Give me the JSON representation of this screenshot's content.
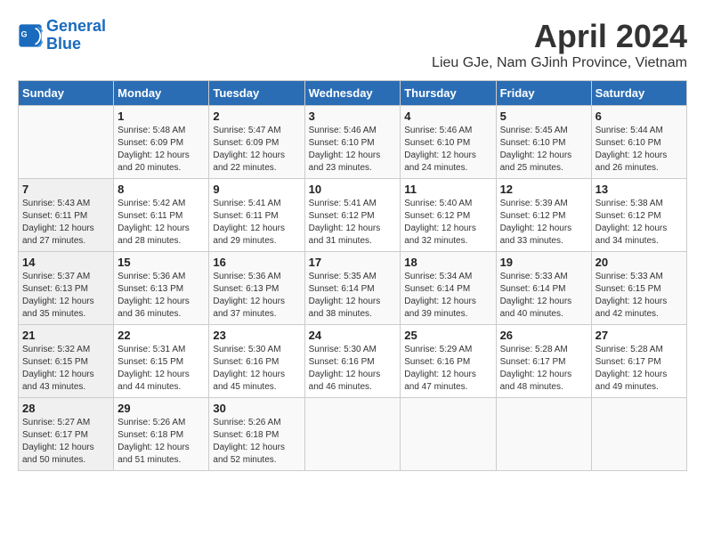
{
  "header": {
    "logo_line1": "General",
    "logo_line2": "Blue",
    "title": "April 2024",
    "subtitle": "Lieu GJe, Nam GJinh Province, Vietnam"
  },
  "calendar": {
    "days_of_week": [
      "Sunday",
      "Monday",
      "Tuesday",
      "Wednesday",
      "Thursday",
      "Friday",
      "Saturday"
    ],
    "weeks": [
      [
        {
          "day": "",
          "info": ""
        },
        {
          "day": "1",
          "info": "Sunrise: 5:48 AM\nSunset: 6:09 PM\nDaylight: 12 hours\nand 20 minutes."
        },
        {
          "day": "2",
          "info": "Sunrise: 5:47 AM\nSunset: 6:09 PM\nDaylight: 12 hours\nand 22 minutes."
        },
        {
          "day": "3",
          "info": "Sunrise: 5:46 AM\nSunset: 6:10 PM\nDaylight: 12 hours\nand 23 minutes."
        },
        {
          "day": "4",
          "info": "Sunrise: 5:46 AM\nSunset: 6:10 PM\nDaylight: 12 hours\nand 24 minutes."
        },
        {
          "day": "5",
          "info": "Sunrise: 5:45 AM\nSunset: 6:10 PM\nDaylight: 12 hours\nand 25 minutes."
        },
        {
          "day": "6",
          "info": "Sunrise: 5:44 AM\nSunset: 6:10 PM\nDaylight: 12 hours\nand 26 minutes."
        }
      ],
      [
        {
          "day": "7",
          "info": "Sunrise: 5:43 AM\nSunset: 6:11 PM\nDaylight: 12 hours\nand 27 minutes."
        },
        {
          "day": "8",
          "info": "Sunrise: 5:42 AM\nSunset: 6:11 PM\nDaylight: 12 hours\nand 28 minutes."
        },
        {
          "day": "9",
          "info": "Sunrise: 5:41 AM\nSunset: 6:11 PM\nDaylight: 12 hours\nand 29 minutes."
        },
        {
          "day": "10",
          "info": "Sunrise: 5:41 AM\nSunset: 6:12 PM\nDaylight: 12 hours\nand 31 minutes."
        },
        {
          "day": "11",
          "info": "Sunrise: 5:40 AM\nSunset: 6:12 PM\nDaylight: 12 hours\nand 32 minutes."
        },
        {
          "day": "12",
          "info": "Sunrise: 5:39 AM\nSunset: 6:12 PM\nDaylight: 12 hours\nand 33 minutes."
        },
        {
          "day": "13",
          "info": "Sunrise: 5:38 AM\nSunset: 6:12 PM\nDaylight: 12 hours\nand 34 minutes."
        }
      ],
      [
        {
          "day": "14",
          "info": "Sunrise: 5:37 AM\nSunset: 6:13 PM\nDaylight: 12 hours\nand 35 minutes."
        },
        {
          "day": "15",
          "info": "Sunrise: 5:36 AM\nSunset: 6:13 PM\nDaylight: 12 hours\nand 36 minutes."
        },
        {
          "day": "16",
          "info": "Sunrise: 5:36 AM\nSunset: 6:13 PM\nDaylight: 12 hours\nand 37 minutes."
        },
        {
          "day": "17",
          "info": "Sunrise: 5:35 AM\nSunset: 6:14 PM\nDaylight: 12 hours\nand 38 minutes."
        },
        {
          "day": "18",
          "info": "Sunrise: 5:34 AM\nSunset: 6:14 PM\nDaylight: 12 hours\nand 39 minutes."
        },
        {
          "day": "19",
          "info": "Sunrise: 5:33 AM\nSunset: 6:14 PM\nDaylight: 12 hours\nand 40 minutes."
        },
        {
          "day": "20",
          "info": "Sunrise: 5:33 AM\nSunset: 6:15 PM\nDaylight: 12 hours\nand 42 minutes."
        }
      ],
      [
        {
          "day": "21",
          "info": "Sunrise: 5:32 AM\nSunset: 6:15 PM\nDaylight: 12 hours\nand 43 minutes."
        },
        {
          "day": "22",
          "info": "Sunrise: 5:31 AM\nSunset: 6:15 PM\nDaylight: 12 hours\nand 44 minutes."
        },
        {
          "day": "23",
          "info": "Sunrise: 5:30 AM\nSunset: 6:16 PM\nDaylight: 12 hours\nand 45 minutes."
        },
        {
          "day": "24",
          "info": "Sunrise: 5:30 AM\nSunset: 6:16 PM\nDaylight: 12 hours\nand 46 minutes."
        },
        {
          "day": "25",
          "info": "Sunrise: 5:29 AM\nSunset: 6:16 PM\nDaylight: 12 hours\nand 47 minutes."
        },
        {
          "day": "26",
          "info": "Sunrise: 5:28 AM\nSunset: 6:17 PM\nDaylight: 12 hours\nand 48 minutes."
        },
        {
          "day": "27",
          "info": "Sunrise: 5:28 AM\nSunset: 6:17 PM\nDaylight: 12 hours\nand 49 minutes."
        }
      ],
      [
        {
          "day": "28",
          "info": "Sunrise: 5:27 AM\nSunset: 6:17 PM\nDaylight: 12 hours\nand 50 minutes."
        },
        {
          "day": "29",
          "info": "Sunrise: 5:26 AM\nSunset: 6:18 PM\nDaylight: 12 hours\nand 51 minutes."
        },
        {
          "day": "30",
          "info": "Sunrise: 5:26 AM\nSunset: 6:18 PM\nDaylight: 12 hours\nand 52 minutes."
        },
        {
          "day": "",
          "info": ""
        },
        {
          "day": "",
          "info": ""
        },
        {
          "day": "",
          "info": ""
        },
        {
          "day": "",
          "info": ""
        }
      ]
    ]
  }
}
